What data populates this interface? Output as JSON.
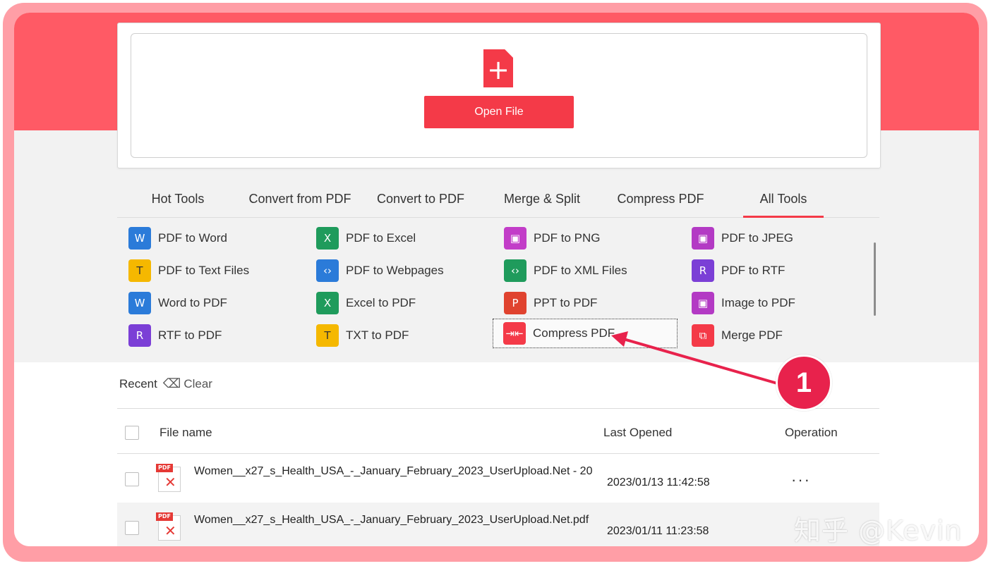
{
  "open_file": {
    "label": "Open File"
  },
  "tabs": [
    {
      "label": "Hot Tools"
    },
    {
      "label": "Convert from PDF"
    },
    {
      "label": "Convert to PDF"
    },
    {
      "label": "Merge & Split"
    },
    {
      "label": "Compress PDF"
    },
    {
      "label": "All Tools"
    }
  ],
  "active_tab": "All Tools",
  "tools": [
    {
      "label": "PDF to Word",
      "color": "#2b7bd9",
      "icon": "word-icon"
    },
    {
      "label": "PDF to Excel",
      "color": "#1f9b5c",
      "icon": "excel-icon"
    },
    {
      "label": "PDF to PNG",
      "color": "#c23dc8",
      "icon": "png-icon"
    },
    {
      "label": "PDF to JPEG",
      "color": "#b33ac4",
      "icon": "jpeg-icon"
    },
    {
      "label": "PDF to Text Files",
      "color": "#f5b800",
      "icon": "text-icon"
    },
    {
      "label": "PDF to Webpages",
      "color": "#2b7bd9",
      "icon": "webpage-icon"
    },
    {
      "label": "PDF to XML Files",
      "color": "#1f9b5c",
      "icon": "xml-icon"
    },
    {
      "label": "PDF to RTF",
      "color": "#7b3fd6",
      "icon": "rtf-icon"
    },
    {
      "label": "Word to PDF",
      "color": "#2b7bd9",
      "icon": "word-icon"
    },
    {
      "label": "Excel to PDF",
      "color": "#1f9b5c",
      "icon": "excel-icon"
    },
    {
      "label": "PPT to PDF",
      "color": "#e0432f",
      "icon": "ppt-icon"
    },
    {
      "label": "Image to PDF",
      "color": "#b33ac4",
      "icon": "image-icon"
    },
    {
      "label": "RTF to PDF",
      "color": "#7b3fd6",
      "icon": "rtf-icon"
    },
    {
      "label": "TXT to PDF",
      "color": "#f5b800",
      "icon": "text-icon"
    },
    {
      "label": "Compress PDF",
      "color": "#f43a48",
      "icon": "compress-icon"
    },
    {
      "label": "Merge PDF",
      "color": "#f43a48",
      "icon": "merge-icon"
    }
  ],
  "recent": {
    "label": "Recent",
    "clear": "Clear"
  },
  "table": {
    "headers": {
      "name": "File name",
      "opened": "Last Opened",
      "operation": "Operation"
    },
    "rows": [
      {
        "name": "Women__x27_s_Health_USA_-_January_February_2023_UserUpload.Net - 20",
        "opened": "2023/01/13 11:42:58",
        "operation": "···"
      },
      {
        "name": "Women__x27_s_Health_USA_-_January_February_2023_UserUpload.Net.pdf",
        "opened": "2023/01/11 11:23:58",
        "operation": ""
      }
    ]
  },
  "callout": {
    "number": "1",
    "color": "#e8224c"
  },
  "watermark": "知乎 @Kevin",
  "colors": {
    "accent": "#f43a48",
    "band": "#ff5a65",
    "frame": "#ff9ea6"
  }
}
